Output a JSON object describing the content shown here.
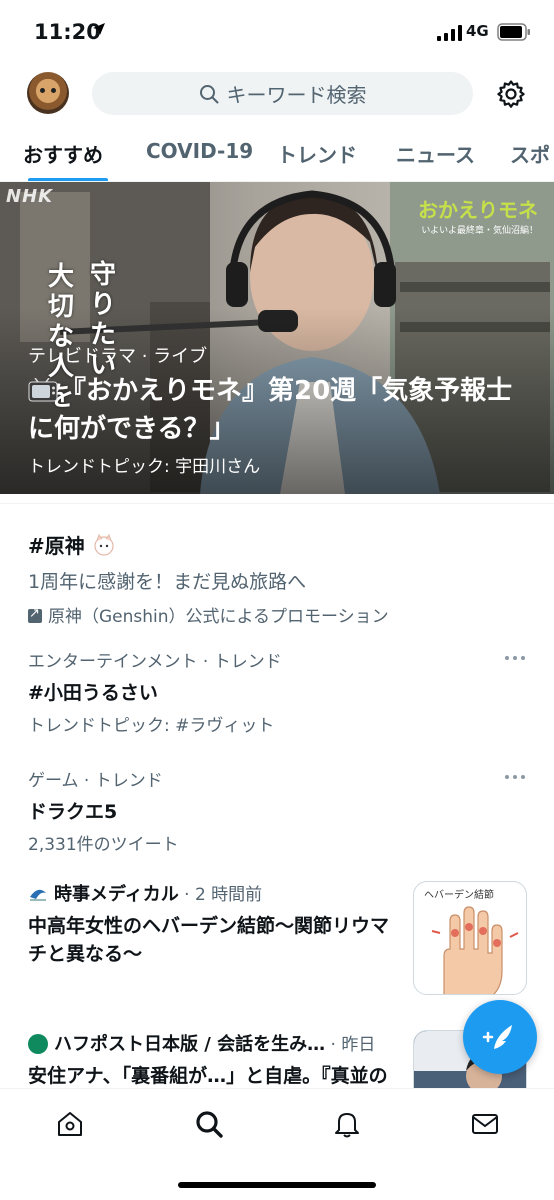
{
  "status_bar": {
    "time": "11:20",
    "network": "4G"
  },
  "header": {
    "search_placeholder": "キーワード検索"
  },
  "tabs": [
    {
      "label": "おすすめ",
      "active": true
    },
    {
      "label": "COVID-19"
    },
    {
      "label": "トレンド"
    },
    {
      "label": "ニュース"
    },
    {
      "label": "スポ"
    }
  ],
  "hero": {
    "watermark": "NHK",
    "vertical_text": [
      "守りたい",
      "大切な人を"
    ],
    "category": "テレビドラマ · ライブ",
    "headline": "『おかえりモネ』第20週「気象予報士に何ができる？」",
    "subtitle": "トレンドトピック: 宇田川さん",
    "program_logo": "おかえりモネ",
    "program_tagline": "いよいよ最終章・気仙沼編！"
  },
  "trends": [
    {
      "title": "#原神",
      "description": "1周年に感謝を！まだ見ぬ旅路へ",
      "promoted_by": "原神（Genshin）公式によるプロモーション"
    },
    {
      "context": "エンターテインメント · トレンド",
      "title": "#小田うるさい",
      "detail": "トレンドトピック: #ラヴィット"
    },
    {
      "context": "ゲーム · トレンド",
      "title": "ドラクエ5",
      "detail": "2,331件のツイート"
    }
  ],
  "news": [
    {
      "source": "時事メディカル",
      "time": "· 2 時間前",
      "title": "中高年女性のヘバーデン結節～関節リウマチと異なる～",
      "thumb_caption": "ヘバーデン結節"
    },
    {
      "source": "ハフポスト日本版 / 会話を生み…",
      "time": "· 昨日",
      "title": "安住アナ、「裏番組が…」と自虐。『真並の三…年間私束行のテレビ放送"
    }
  ],
  "colors": {
    "accent": "#1d9bf0",
    "secondary_text": "#536471",
    "primary_text": "#0f1419"
  }
}
